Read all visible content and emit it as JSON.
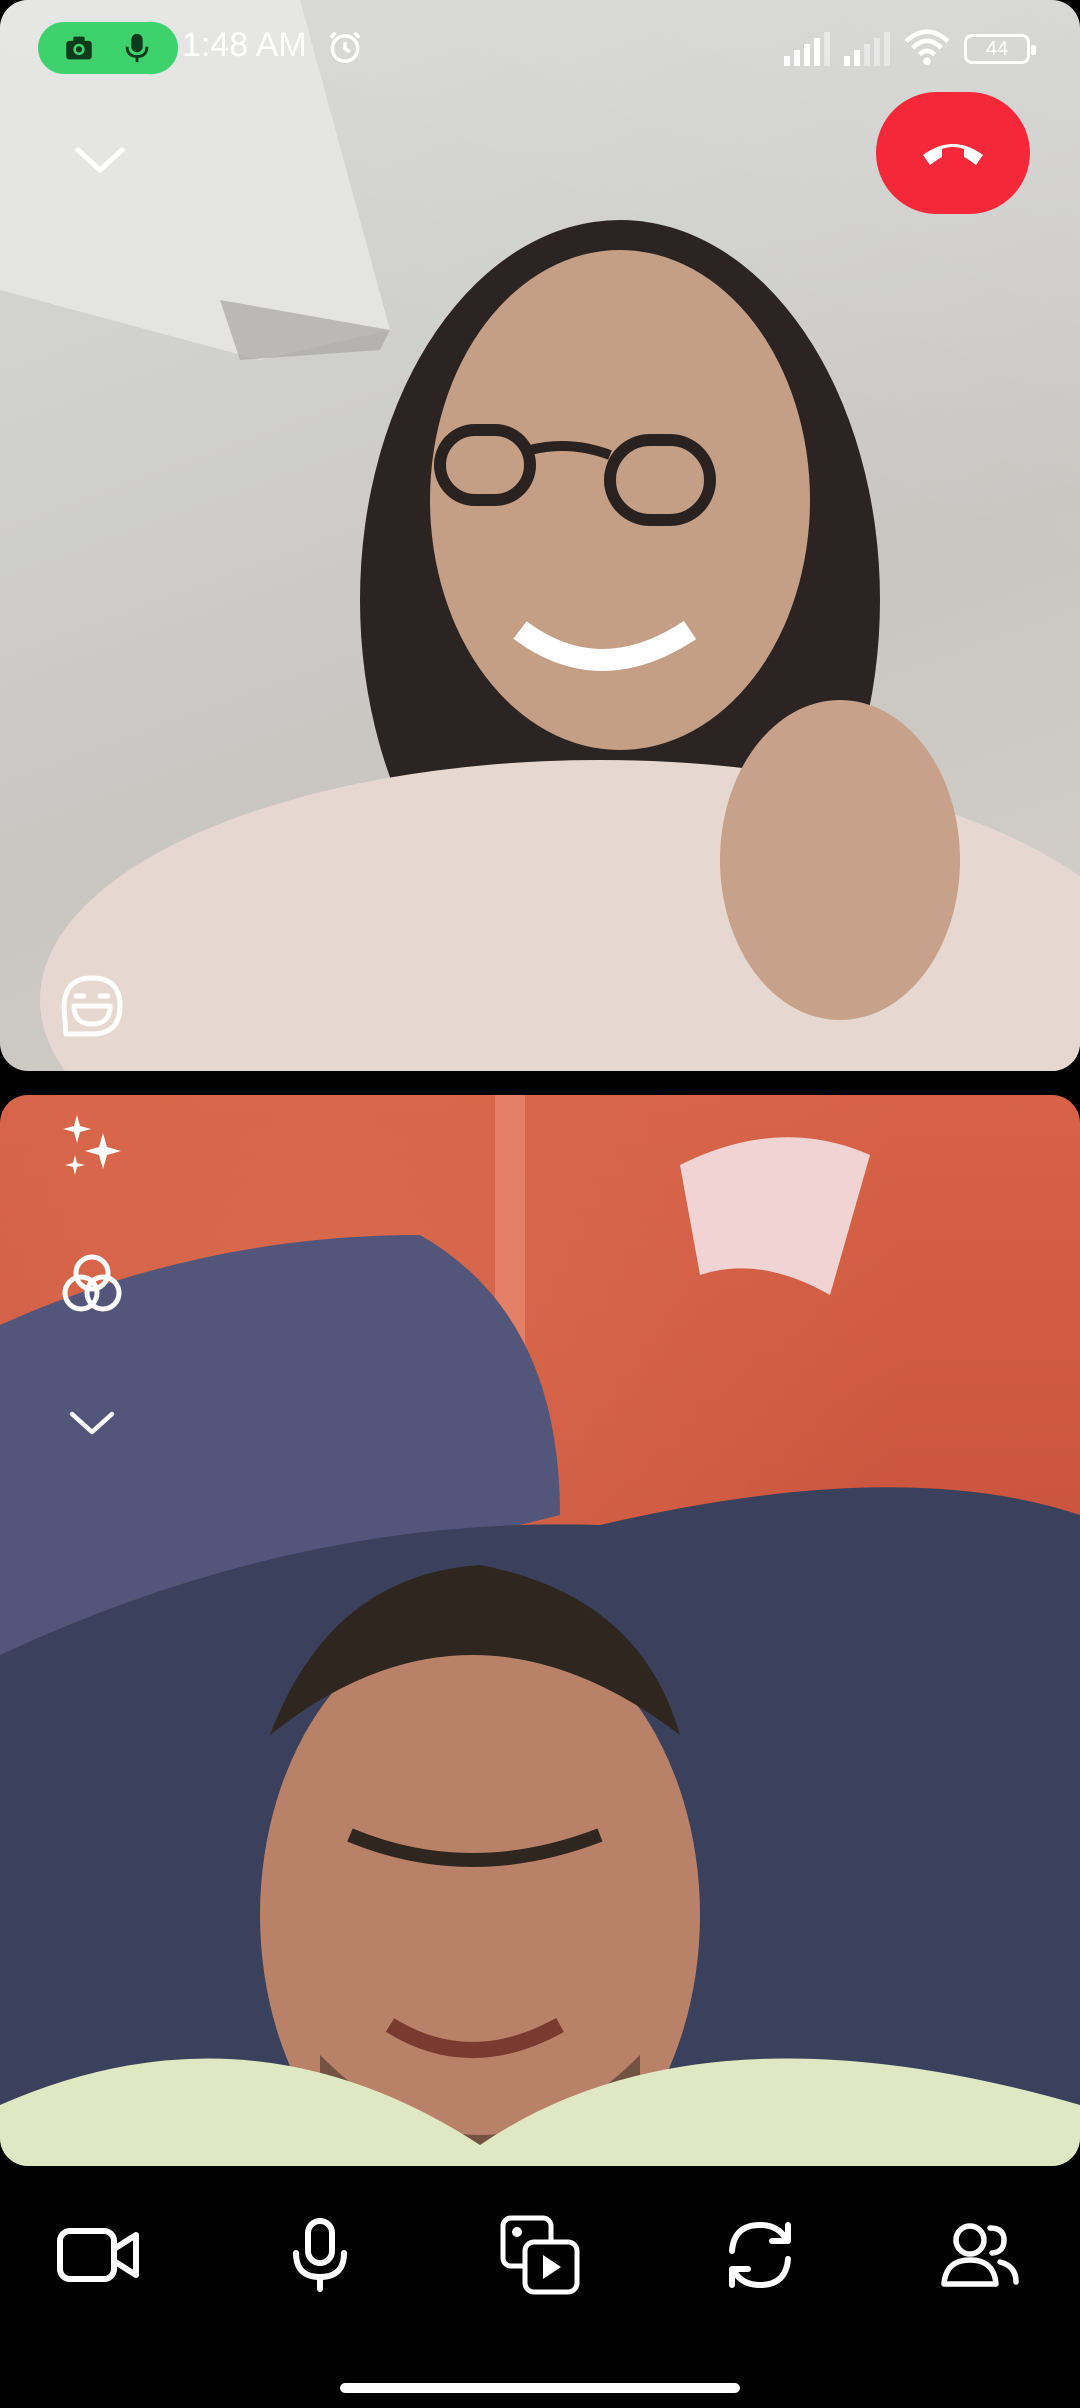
{
  "status_bar": {
    "time": "1:48 AM",
    "battery": "44",
    "recording_pill_color": "#3dd26b",
    "icons": [
      "camera-icon",
      "mic-icon",
      "alarm-icon",
      "signal-icon",
      "signal-icon",
      "wifi-icon",
      "battery-icon"
    ]
  },
  "call": {
    "end_call_color": "#f5283a"
  },
  "remote_tile": {
    "icons": [
      "chevron-down-icon",
      "end-call-icon",
      "emoji-face-icon"
    ]
  },
  "local_tile": {
    "icons": [
      "sparkles-icon",
      "filters-icon",
      "chevron-down-icon"
    ]
  },
  "toolbar": {
    "buttons": [
      "video-camera-icon",
      "microphone-icon",
      "media-share-icon",
      "flip-camera-icon",
      "participants-icon"
    ]
  }
}
